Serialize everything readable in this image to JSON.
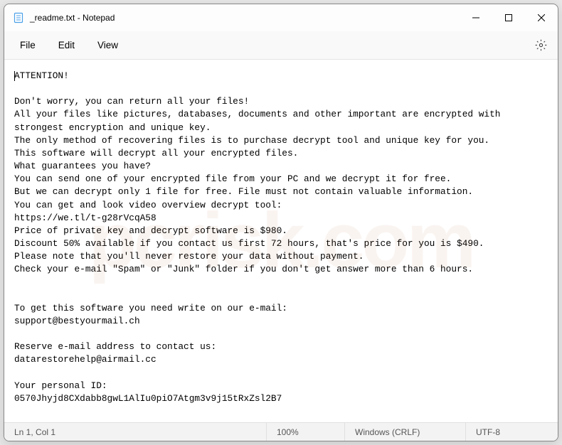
{
  "titlebar": {
    "title": "_readme.txt - Notepad"
  },
  "menu": {
    "file": "File",
    "edit": "Edit",
    "view": "View"
  },
  "content": {
    "body": "ATTENTION!\n\nDon't worry, you can return all your files!\nAll your files like pictures, databases, documents and other important are encrypted with strongest encryption and unique key.\nThe only method of recovering files is to purchase decrypt tool and unique key for you.\nThis software will decrypt all your encrypted files.\nWhat guarantees you have?\nYou can send one of your encrypted file from your PC and we decrypt it for free.\nBut we can decrypt only 1 file for free. File must not contain valuable information.\nYou can get and look video overview decrypt tool:\nhttps://we.tl/t-g28rVcqA58\nPrice of private key and decrypt software is $980.\nDiscount 50% available if you contact us first 72 hours, that's price for you is $490.\nPlease note that you'll never restore your data without payment.\nCheck your e-mail \"Spam\" or \"Junk\" folder if you don't get answer more than 6 hours.\n\n\nTo get this software you need write on our e-mail:\nsupport@bestyourmail.ch\n\nReserve e-mail address to contact us:\ndatarestorehelp@airmail.cc\n\nYour personal ID:\n0570Jhyjd8CXdabb8gwL1AlIu0piO7Atgm3v9j15tRxZsl2B7"
  },
  "status": {
    "position": "Ln 1, Col 1",
    "zoom": "100%",
    "eol": "Windows (CRLF)",
    "encoding": "UTF-8"
  },
  "watermark": {
    "text": "pcrisk.com"
  }
}
